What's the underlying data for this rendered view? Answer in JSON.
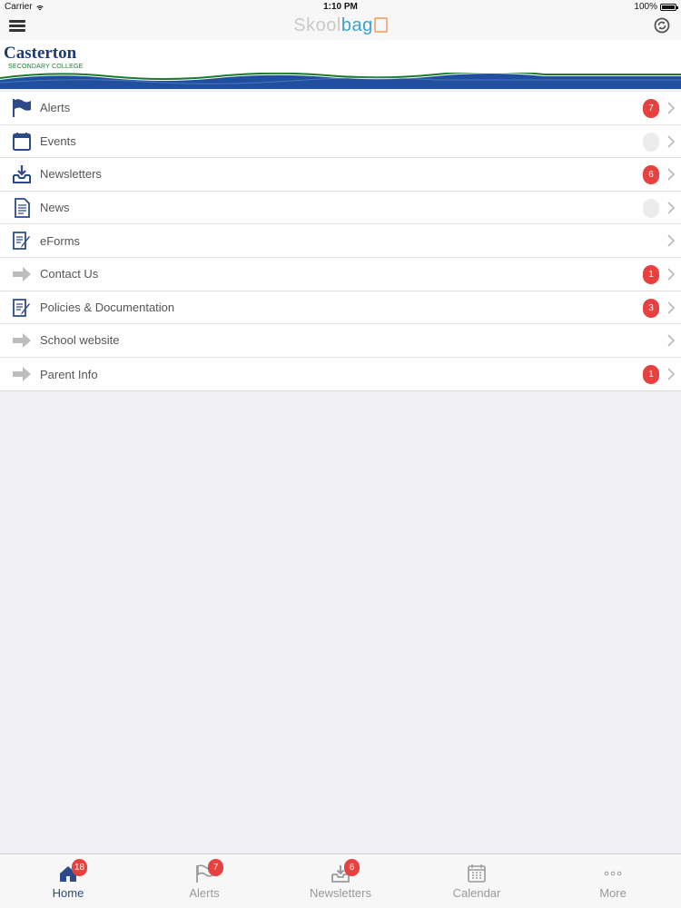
{
  "status_bar": {
    "carrier": "Carrier",
    "time": "1:10 PM",
    "battery": "100%"
  },
  "header": {
    "brand_part1": "Skool",
    "brand_part2": "bag"
  },
  "school": {
    "name": "Casterton",
    "subtitle": "SECONDARY COLLEGE"
  },
  "menu": [
    {
      "label": "Alerts",
      "badge": "7",
      "icon": "flag-icon"
    },
    {
      "label": "Events",
      "badge": "",
      "icon": "calendar-icon"
    },
    {
      "label": "Newsletters",
      "badge": "6",
      "icon": "inbox-download-icon"
    },
    {
      "label": "News",
      "badge": "",
      "icon": "document-icon"
    },
    {
      "label": "eForms",
      "badge": null,
      "icon": "form-pencil-icon"
    },
    {
      "label": "Contact Us",
      "badge": "1",
      "icon": "arrow-right-icon"
    },
    {
      "label": "Policies & Documentation",
      "badge": "3",
      "icon": "form-pencil-icon"
    },
    {
      "label": "School website",
      "badge": null,
      "icon": "arrow-right-icon"
    },
    {
      "label": "Parent Info",
      "badge": "1",
      "icon": "arrow-right-icon"
    }
  ],
  "tabs": [
    {
      "label": "Home",
      "badge": "18",
      "icon": "home-icon",
      "active": true
    },
    {
      "label": "Alerts",
      "badge": "7",
      "icon": "flag-icon",
      "active": false
    },
    {
      "label": "Newsletters",
      "badge": "6",
      "icon": "inbox-download-icon",
      "active": false
    },
    {
      "label": "Calendar",
      "badge": null,
      "icon": "calendar-icon",
      "active": false
    },
    {
      "label": "More",
      "badge": null,
      "icon": "more-dots-icon",
      "active": false
    }
  ],
  "colors": {
    "accent": "#2d4a8a",
    "badge": "#e8403e",
    "brand_blue": "#3aa3c9",
    "wave_green": "#1a7a2e",
    "wave_blue": "#1f4f9e"
  }
}
